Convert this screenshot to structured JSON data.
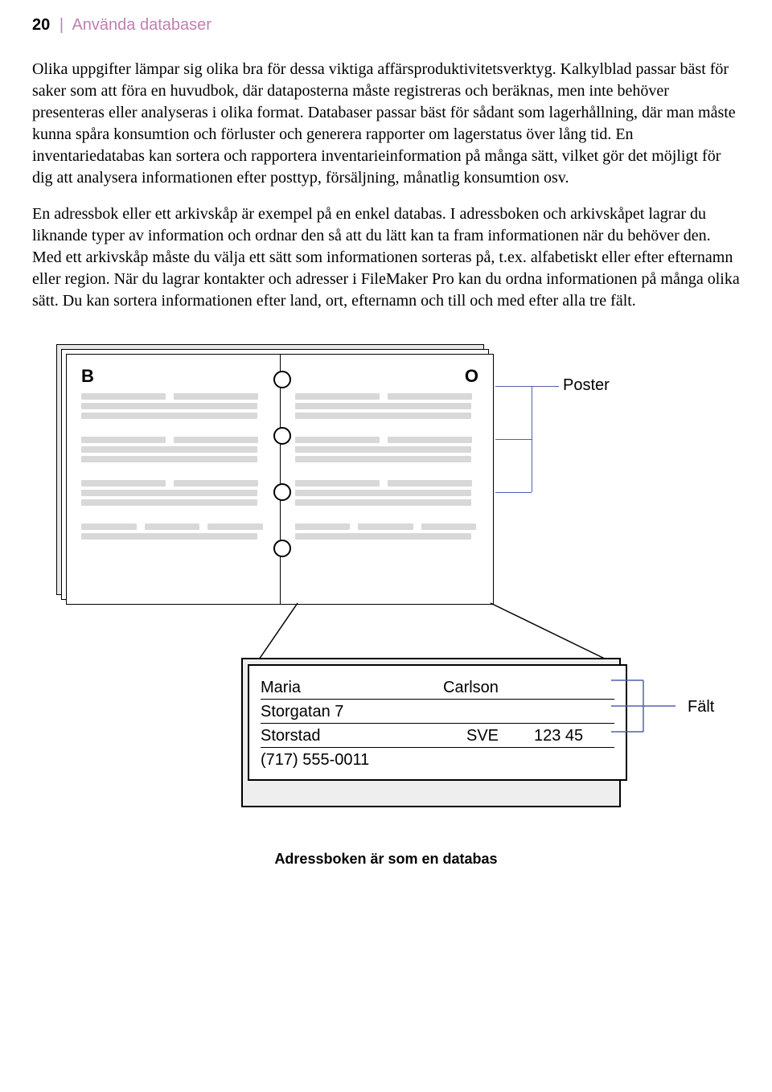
{
  "header": {
    "page_number": "20",
    "separator": "|",
    "section_title": "Använda databaser"
  },
  "paragraphs": {
    "p1": "Olika uppgifter lämpar sig olika bra för dessa viktiga affärsproduktivitetsverktyg. Kalkylblad passar bäst för saker som att föra en huvudbok, där dataposterna måste registreras och beräknas, men inte behöver presenteras eller analyseras i olika format. Databaser passar bäst för sådant som lagerhållning, där man måste kunna spåra konsumtion och förluster och generera rapporter om lagerstatus över lång tid. En inventariedatabas kan sortera och rapportera inventarieinformation på många sätt, vilket gör det möjligt för dig att analysera informationen efter posttyp, försäljning, månatlig konsumtion osv.",
    "p2": "En adressbok eller ett arkivskåp är exempel på en enkel databas. I adressboken och arkivskåpet lagrar du liknande typer av information och ordnar den så att du lätt kan ta fram informationen när du behöver den. Med ett arkivskåp måste du välja ett sätt som informationen sorteras på, t.ex. alfabetiskt eller efter efternamn eller region. När du lagrar kontakter och adresser i FileMaker Pro kan du ordna informationen på många olika sätt. Du kan sortera informationen efter land, ort, efternamn och till och med efter alla tre fält."
  },
  "figure": {
    "left_tab": "B",
    "right_tab": "O",
    "poster_label": "Poster",
    "falt_label": "Fält",
    "caption": "Adressboken är som en databas",
    "detail": {
      "first_name": "Maria",
      "last_name": "Carlson",
      "street": "Storgatan 7",
      "city": "Storstad",
      "country": "SVE",
      "postal": "123 45",
      "phone": "(717) 555-0011"
    }
  }
}
